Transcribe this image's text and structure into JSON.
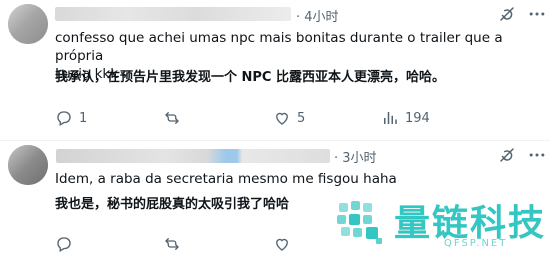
{
  "tweets": [
    {
      "time": "· 4小时",
      "text_original": "confesso que achei umas npc mais bonitas durante o trailer que a própria\nLucia kkk",
      "text_translation": "我承认，在预告片里我发现一个 NPC 比露西亚本人更漂亮，哈哈。",
      "actions": {
        "reply": "1",
        "retweet": "",
        "like": "5",
        "views": "194"
      }
    },
    {
      "time": "· 3小时",
      "text_original": "Idem, a raba da secretaria mesmo me fisgou haha",
      "text_translation": "我也是，秘书的屁股真的太吸引我了哈哈",
      "actions": {
        "reply": "",
        "retweet": "",
        "like": "",
        "views": ""
      }
    }
  ],
  "watermark": {
    "title": "量链科技",
    "subtitle": "QFSP.NET"
  },
  "colors": {
    "text": "#0f1419",
    "muted": "#536471",
    "divider": "#eff3f4",
    "watermark": "#34c6c2"
  },
  "icons": [
    "grok-icon",
    "more-icon",
    "reply-icon",
    "retweet-icon",
    "like-icon",
    "views-icon"
  ]
}
